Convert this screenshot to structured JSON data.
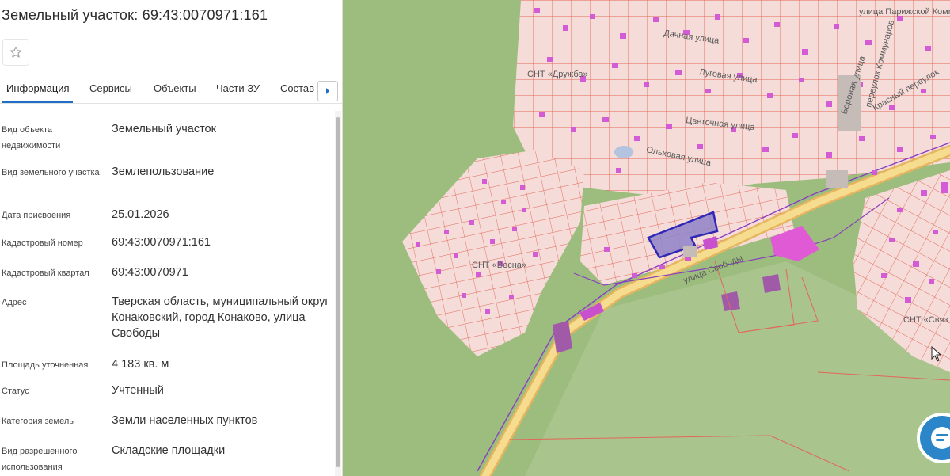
{
  "panel": {
    "title": "Земельный участок: 69:43:0070971:161",
    "tabs": [
      {
        "label": "Информация",
        "active": true
      },
      {
        "label": "Сервисы"
      },
      {
        "label": "Объекты"
      },
      {
        "label": "Части ЗУ"
      },
      {
        "label": "Состав"
      }
    ],
    "properties": [
      {
        "label": "Вид объекта недвижимости",
        "value": "Земельный участок"
      },
      {
        "label": "Вид земельного участка",
        "value": "Землепользование"
      },
      {
        "label": "Дата присвоения",
        "value": "25.01.2026"
      },
      {
        "label": "Кадастровый номер",
        "value": "69:43:0070971:161"
      },
      {
        "label": "Кадастровый квартал",
        "value": "69:43:0070971"
      },
      {
        "label": "Адрес",
        "value": "Тверская область, муниципальный округ Конаковский, город Конаково, улица Свободы"
      },
      {
        "label": "Площадь уточненная",
        "value": "4 183 кв. м"
      },
      {
        "label": "Статус",
        "value": "Учтенный"
      },
      {
        "label": "Категория земель",
        "value": "Земли населенных пунктов"
      },
      {
        "label": "Вид разрешенного использования",
        "value": "Складские площадки"
      }
    ]
  },
  "map": {
    "labels": {
      "snt_druzhba": "СНТ «Дружба»",
      "snt_vesna": "СНТ «Весна»",
      "snt_svyaz": "СНТ «Связ",
      "dachnaya": "Дачная улица",
      "lugovaya": "Луговая улица",
      "tsvetochnaya": "Цветочная улица",
      "olkhovaya": "Ольховая улица",
      "svobody": "улица Свободы",
      "parizhskoy": "улица Парижской Комм",
      "borovaya": "Боровая улица",
      "krasny": "Красный переулок",
      "kommunarov": "переулок Коммунаров"
    },
    "colors": {
      "forest": "#9cbd7e",
      "field": "#a9c48c",
      "urban": "#f2e5e3",
      "parcel_stroke": "#e2675a",
      "building": "#d35bd6",
      "selected_fill": "#8f82c9",
      "selected_stroke": "#2f27b5",
      "road": "#f3cf74"
    }
  },
  "icons": {
    "favorite": "star-outline-icon",
    "tabs_next": "chevron-right-icon",
    "chat": "chat-bubble-icon"
  }
}
